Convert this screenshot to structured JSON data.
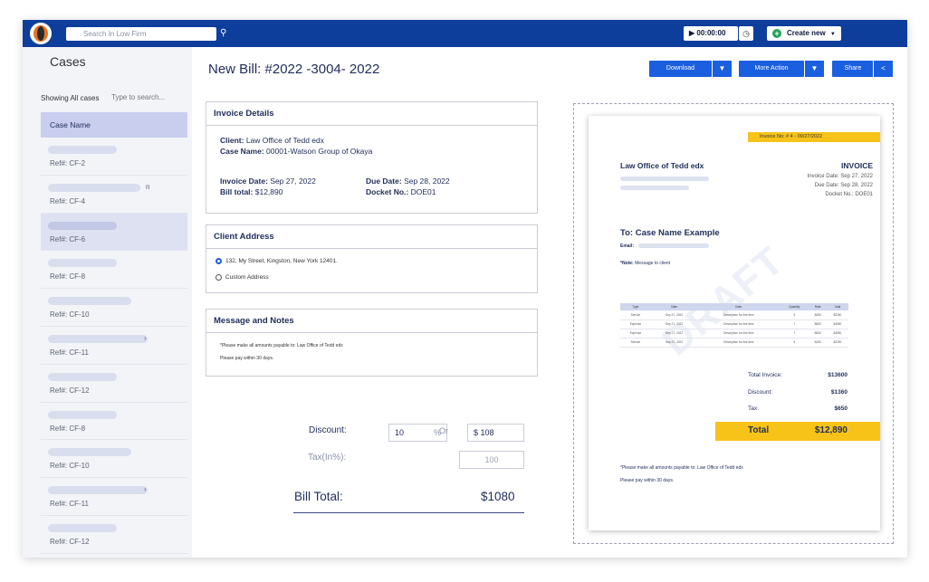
{
  "topbar": {
    "search_placeholder": "Search In Low Firm",
    "timer": "00:00:00",
    "create_label": "Create new"
  },
  "sidebar": {
    "title": "Cases",
    "showing": "Showing All cases",
    "search_placeholder": "Type to search...",
    "header": "Case Name",
    "items": [
      {
        "ref": "Ref#: CF-2",
        "trail": ""
      },
      {
        "ref": "Ref#: CF-4",
        "trail": "n"
      },
      {
        "ref": "Ref#: CF-6",
        "trail": ""
      },
      {
        "ref": "Ref#: CF-8",
        "trail": ""
      },
      {
        "ref": "Ref#: CF-10",
        "trail": ""
      },
      {
        "ref": "Ref#: CF-11",
        "trail": "›"
      },
      {
        "ref": "Ref#: CF-12",
        "trail": ""
      },
      {
        "ref": "Ref#: CF-8",
        "trail": ""
      },
      {
        "ref": "Ref#: CF-10",
        "trail": ""
      },
      {
        "ref": "Ref#: CF-11",
        "trail": "›"
      },
      {
        "ref": "Ref#: CF-12",
        "trail": ""
      }
    ]
  },
  "main": {
    "title": "New Bill: #2022 -3004- 2022",
    "download": "Download",
    "more_action": "More Action",
    "share": "Share",
    "invoice_details": {
      "title": "Invoice Details",
      "client_label": "Client:",
      "client": "Law Office of Tedd edx",
      "case_label": "Case Name:",
      "case": "00001-Watson Group of Okaya",
      "inv_date_label": "Invoice Date:",
      "inv_date": "Sep 27, 2022",
      "due_label": "Due Date:",
      "due": "Sep 28, 2022",
      "bill_total_label": "Bill total:",
      "bill_total": "$12,890",
      "docket_label": "Docket No.:",
      "docket": "DOE01"
    },
    "client_address": {
      "title": "Client Address",
      "option1": "132, My Street, Kingston, New York 12401.",
      "option2": "Custom Address"
    },
    "notes": {
      "title": "Message and Notes",
      "line1": "*Please make all amounts payable to: Law Office of Tedd edx",
      "line2": "Please pay within 30 days."
    },
    "discount_label": "Discount:",
    "discount_value": "10",
    "percent": "%",
    "or": "Or",
    "dollar_value": "$ 108",
    "tax_label": "Tax(In%):",
    "tax_value": "100",
    "bill_total_label": "Bill Total:",
    "bill_total_value": "$1080"
  },
  "preview": {
    "invoice_no": "Invoice  No: # 4 - 09/27/2022",
    "firm": "Law Office of Tedd edx",
    "invoice": "INVOICE",
    "inv_date": "Invoice Date: Sep 27, 2022",
    "due_date": "Due Date: Sep 28, 2022",
    "docket": "Docket No.: DOE01",
    "to": "To: Case Name Example",
    "email": "Email:",
    "note_label": "*Note:",
    "note": "Message to client",
    "watermark": "DRAFT",
    "columns": [
      "Type",
      "Date",
      "Note",
      "Quantity",
      "Rate",
      "Total"
    ],
    "rows": [
      [
        "Service",
        "Sep 27, 2022",
        "Description for line item",
        "5",
        "$450",
        "$2250"
      ],
      [
        "Expense",
        "Sep 27, 2022",
        "Description for line item",
        "7",
        "$650",
        "$4550"
      ],
      [
        "Expense",
        "Sep 27, 2022",
        "Description for line item",
        "7",
        "$650",
        "$4550"
      ],
      [
        "Service",
        "Sep 27, 2022",
        "Description for line item",
        "5",
        "$450",
        "$2250"
      ]
    ],
    "total_invoice_label": "Total Invoice:",
    "total_invoice": "$13600",
    "discount_label": "Discount:",
    "discount": "$1360",
    "tax_label": "Tax:",
    "tax": "$650",
    "total_label": "Total",
    "total": "$12,890",
    "footer1": "*Please make all amounts payable to: Law Office of Tedd edx",
    "footer2": "Please pay within 30 days."
  },
  "colors": {
    "topbar": "#0e3e9c",
    "accent": "#1a5fe0",
    "highlight": "#f7c319"
  }
}
